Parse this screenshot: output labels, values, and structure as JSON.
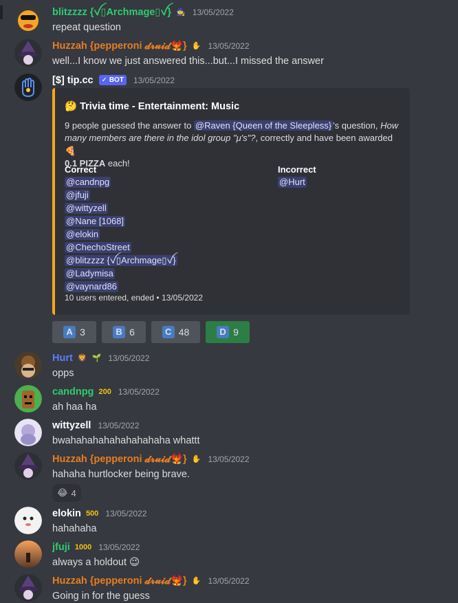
{
  "colors": {
    "background": "#36393f",
    "green_name": "#2ecc71",
    "orange_name": "#e67e22",
    "blue_name": "#5c7cfa",
    "white_name": "#ffffff",
    "embed_accent": "#faa61a",
    "mention_bg": "#5865f2"
  },
  "messages": {
    "m1": {
      "username": "blitzzzz {ꪜ▯Archmage▯ꪜ}",
      "time": "13/05/2022",
      "text": "repeat question",
      "avatar_icon": "orange-cartoon-avatar"
    },
    "m2": {
      "username": "Huzzah {pepperoni 𝓭𝓻𝓾𝓲𝓭🐦‍🔥}",
      "time": "13/05/2022",
      "text": "well...I know we just answered this...but...I missed the answer",
      "avatar_icon": "wizard-hat-avatar"
    },
    "m3": {
      "username": "[$] tip.cc",
      "bot_label": "✓ BOT",
      "time": "13/05/2022",
      "avatar_icon": "hand-logo-avatar",
      "embed": {
        "title": "🤔 Trivia time - Entertainment: Music",
        "desc_pre": "9 people guessed the answer to ",
        "desc_mention": "@Raven {Queen of the Sleepless}",
        "desc_mid": "'s question, ",
        "desc_question": "How many members are there in the idol group \"μ's\"?",
        "desc_post": ", correctly and have been awarded",
        "desc_amount": "0.1 PIZZA",
        "desc_end": " each!",
        "correct_label": "Correct",
        "incorrect_label": "Incorrect",
        "correct": [
          "@candnpg",
          "@jfuji",
          "@wittyzell",
          "@Nane [1068]",
          "@elokin",
          "@ChechoStreet",
          "@blitzzzz {ꪜ▯Archmage▯ꪜ}",
          "@Ladymisa",
          "@vaynard86"
        ],
        "incorrect": [
          "@Hurt"
        ],
        "footer": "10 users entered, ended • 13/05/2022"
      },
      "buttons": [
        {
          "letter": "A",
          "count": "3"
        },
        {
          "letter": "B",
          "count": "6"
        },
        {
          "letter": "C",
          "count": "48"
        },
        {
          "letter": "D",
          "count": "9"
        }
      ]
    },
    "m4": {
      "username": "Hurt",
      "time": "13/05/2022",
      "text": "opps",
      "avatar_icon": "anime-avatar"
    },
    "m5": {
      "username": "candnpg",
      "time": "13/05/2022",
      "text": "ah haa ha",
      "badge": "200",
      "avatar_icon": "green-tiki-avatar"
    },
    "m6": {
      "username": "wittyzell",
      "time": "13/05/2022",
      "text": "bwahahahahahahahahaha whattt",
      "avatar_icon": "anime-girl-avatar"
    },
    "m7": {
      "username": "Huzzah {pepperoni 𝓭𝓻𝓾𝓲𝓭🐦‍🔥}",
      "time": "13/05/2022",
      "text": "hahaha hurtlocker being brave.",
      "avatar_icon": "wizard-hat-avatar",
      "reaction": {
        "emoji": "😂",
        "count": "4"
      }
    },
    "m8": {
      "username": "elokin",
      "time": "13/05/2022",
      "text": "hahahaha",
      "badge": "500",
      "avatar_icon": "ghost-avatar"
    },
    "m9": {
      "username": "jfuji",
      "time": "13/05/2022",
      "text": "always a holdout",
      "badge": "1000",
      "text_emoji": "😉",
      "avatar_icon": "sunset-avatar"
    },
    "m10": {
      "username": "Huzzah {pepperoni 𝓭𝓻𝓾𝓲𝓭🐦‍🔥}",
      "time": "13/05/2022",
      "text": "Going in for the guess",
      "avatar_icon": "wizard-hat-avatar"
    }
  }
}
